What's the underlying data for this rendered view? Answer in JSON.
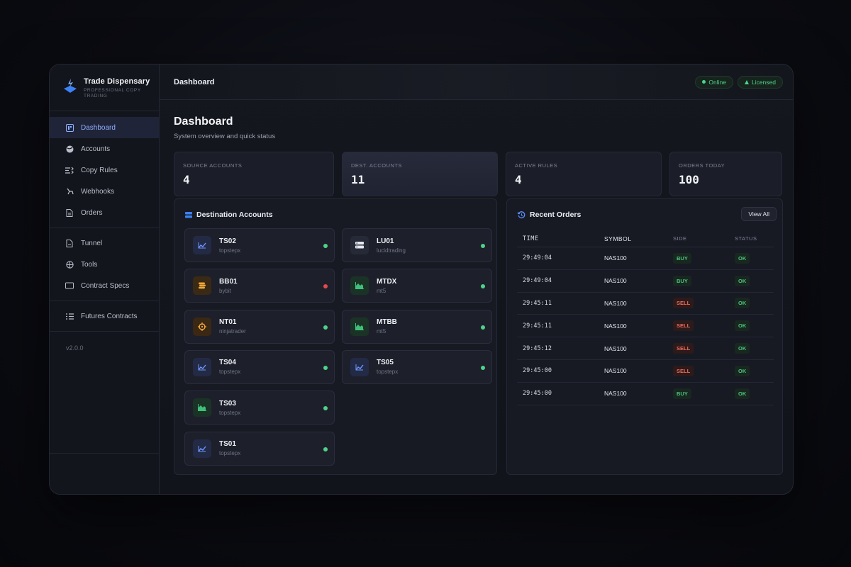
{
  "brand": {
    "name": "Trade Dispensary",
    "subtitle": "PROFESSIONAL COPY TRADING"
  },
  "sidebar": {
    "items": [
      {
        "label": "Dashboard",
        "icon": "dashboard-icon",
        "active": true
      },
      {
        "label": "Accounts",
        "icon": "globe-icon"
      },
      {
        "label": "Copy Rules",
        "icon": "copy-rules-icon"
      },
      {
        "label": "Webhooks",
        "icon": "webhook-icon"
      },
      {
        "label": "Orders",
        "icon": "orders-icon"
      },
      {
        "label": "Tunnel",
        "icon": "tunnel-icon"
      },
      {
        "label": "Tools",
        "icon": "tools-icon"
      },
      {
        "label": "Contract Specs",
        "icon": "contract-specs-icon"
      },
      {
        "label": "Futures Contracts",
        "icon": "list-icon"
      }
    ],
    "version": "v2.0.0"
  },
  "header": {
    "title": "Dashboard",
    "badges": [
      {
        "label": "Online",
        "icon": "dot-icon"
      },
      {
        "label": "Licensed",
        "icon": "triangle-icon"
      }
    ]
  },
  "page": {
    "title": "Dashboard",
    "subtitle": "System overview and quick status"
  },
  "stats": [
    {
      "label": "SOURCE ACCOUNTS",
      "value": "4"
    },
    {
      "label": "DEST. ACCOUNTS",
      "value": "11"
    },
    {
      "label": "ACTIVE RULES",
      "value": "4"
    },
    {
      "label": "ORDERS TODAY",
      "value": "100"
    }
  ],
  "destinations": {
    "title": "Destination Accounts",
    "accounts": [
      {
        "name": "TS02",
        "platform": "topstepx",
        "icon": "line-chart-icon",
        "status": "online"
      },
      {
        "name": "LU01",
        "platform": "lucidtrading",
        "icon": "server-icon",
        "status": "online"
      },
      {
        "name": "BB01",
        "platform": "bybit",
        "icon": "coins-icon",
        "status": "offline"
      },
      {
        "name": "MTDX",
        "platform": "mt5",
        "icon": "area-chart-icon",
        "status": "online"
      },
      {
        "name": "NT01",
        "platform": "ninjatrader",
        "icon": "crosshair-icon",
        "status": "online"
      },
      {
        "name": "MTBB",
        "platform": "mt5",
        "icon": "area-chart-icon",
        "status": "online"
      },
      {
        "name": "TS04",
        "platform": "topstepx",
        "icon": "line-chart-icon",
        "status": "online"
      },
      {
        "name": "TS05",
        "platform": "topstepx",
        "icon": "line-chart-icon",
        "status": "online"
      },
      {
        "name": "TS03",
        "platform": "topstepx",
        "icon": "area-chart-icon",
        "status": "online"
      },
      {
        "name": "TS01",
        "platform": "topstepx",
        "icon": "line-chart-icon",
        "status": "online"
      }
    ]
  },
  "recent_orders": {
    "title": "Recent Orders",
    "view_all": "View All",
    "columns": [
      "TIME",
      "SYMBOL",
      "SIDE",
      "STATUS"
    ],
    "rows": [
      {
        "time": "29:49:04",
        "symbol": "NAS100",
        "side": "BUY",
        "status": "OK"
      },
      {
        "time": "29:49:04",
        "symbol": "NAS100",
        "side": "BUY",
        "status": "OK"
      },
      {
        "time": "29:45:11",
        "symbol": "NAS100",
        "side": "SELL",
        "status": "OK"
      },
      {
        "time": "29:45:11",
        "symbol": "NAS100",
        "side": "SELL",
        "status": "OK"
      },
      {
        "time": "29:45:12",
        "symbol": "NAS100",
        "side": "SELL",
        "status": "OK"
      },
      {
        "time": "29:45:00",
        "symbol": "NAS100",
        "side": "SELL",
        "status": "OK"
      },
      {
        "time": "29:45:00",
        "symbol": "NAS100",
        "side": "BUY",
        "status": "OK"
      }
    ]
  },
  "colors": {
    "accent": "#8fb0ff",
    "online": "#4fd38a",
    "offline": "#e5484d",
    "buy": "#4cc37e",
    "sell": "#ef6b5f"
  }
}
